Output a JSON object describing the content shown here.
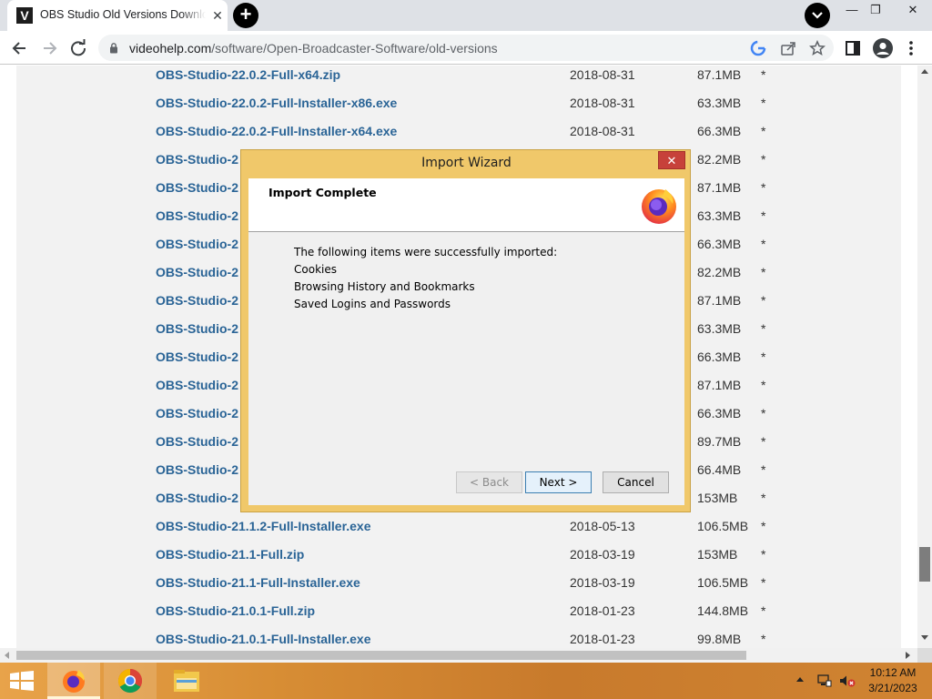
{
  "browser": {
    "tab_title": "OBS Studio Old Versions Download",
    "tab_favicon": "V",
    "tab_close": "✕",
    "new_tab": "+",
    "url_host": "videohelp.com",
    "url_path": "/software/Open-Broadcaster-Software/old-versions",
    "window_controls": {
      "minimize": "—",
      "restore": "❐",
      "close": "✕"
    }
  },
  "files": [
    {
      "name": "OBS-Studio-22.0.2-Full-x64.zip",
      "date": "2018-08-31",
      "size": "87.1MB",
      "mark": "*"
    },
    {
      "name": "OBS-Studio-22.0.2-Full-Installer-x86.exe",
      "date": "2018-08-31",
      "size": "63.3MB",
      "mark": "*"
    },
    {
      "name": "OBS-Studio-22.0.2-Full-Installer-x64.exe",
      "date": "2018-08-31",
      "size": "66.3MB",
      "mark": "*"
    },
    {
      "name": "OBS-Studio-2",
      "date": "",
      "size": "82.2MB",
      "mark": "*"
    },
    {
      "name": "OBS-Studio-2",
      "date": "",
      "size": "87.1MB",
      "mark": "*"
    },
    {
      "name": "OBS-Studio-2",
      "date": "",
      "size": "63.3MB",
      "mark": "*"
    },
    {
      "name": "OBS-Studio-2",
      "date": "",
      "size": "66.3MB",
      "mark": "*"
    },
    {
      "name": "OBS-Studio-2",
      "date": "",
      "size": "82.2MB",
      "mark": "*"
    },
    {
      "name": "OBS-Studio-2",
      "date": "",
      "size": "87.1MB",
      "mark": "*"
    },
    {
      "name": "OBS-Studio-2",
      "date": "",
      "size": "63.3MB",
      "mark": "*"
    },
    {
      "name": "OBS-Studio-2",
      "date": "",
      "size": "66.3MB",
      "mark": "*"
    },
    {
      "name": "OBS-Studio-2",
      "date": "",
      "size": "87.1MB",
      "mark": "*"
    },
    {
      "name": "OBS-Studio-2",
      "date": "",
      "size": "66.3MB",
      "mark": "*"
    },
    {
      "name": "OBS-Studio-2",
      "date": "",
      "size": "89.7MB",
      "mark": "*"
    },
    {
      "name": "OBS-Studio-2",
      "date": "",
      "size": "66.4MB",
      "mark": "*"
    },
    {
      "name": "OBS-Studio-2",
      "date": "",
      "size": "153MB",
      "mark": "*"
    },
    {
      "name": "OBS-Studio-21.1.2-Full-Installer.exe",
      "date": "2018-05-13",
      "size": "106.5MB",
      "mark": "*"
    },
    {
      "name": "OBS-Studio-21.1-Full.zip",
      "date": "2018-03-19",
      "size": "153MB",
      "mark": "*"
    },
    {
      "name": "OBS-Studio-21.1-Full-Installer.exe",
      "date": "2018-03-19",
      "size": "106.5MB",
      "mark": "*"
    },
    {
      "name": "OBS-Studio-21.0.1-Full.zip",
      "date": "2018-01-23",
      "size": "144.8MB",
      "mark": "*"
    },
    {
      "name": "OBS-Studio-21.0.1-Full-Installer.exe",
      "date": "2018-01-23",
      "size": "99.8MB",
      "mark": "*"
    }
  ],
  "dialog": {
    "title": "Import Wizard",
    "close": "✕",
    "header_title": "Import Complete",
    "intro": "The following items were successfully imported:",
    "items": [
      "Cookies",
      "Browsing History and Bookmarks",
      "Saved Logins and Passwords"
    ],
    "back_label": "< Back",
    "next_label": "Next >",
    "cancel_label": "Cancel"
  },
  "taskbar": {
    "time": "10:12 AM",
    "date": "3/21/2023"
  },
  "colors": {
    "link": "#2a6496",
    "dialog_frame": "#f0c86a",
    "taskbar": "#d78d34",
    "close_red": "#c7413a"
  },
  "icons": [
    "windows-start-icon",
    "firefox-icon",
    "chrome-icon",
    "file-explorer-icon",
    "network-icon",
    "volume-muted-icon",
    "lock-icon",
    "google-icon",
    "share-icon",
    "star-icon",
    "sidepanel-icon",
    "profile-icon",
    "menu-icon"
  ]
}
